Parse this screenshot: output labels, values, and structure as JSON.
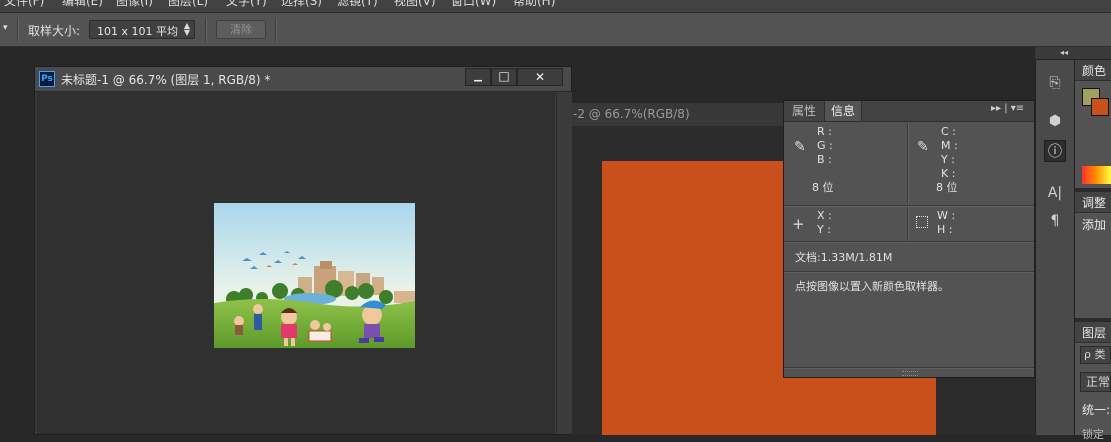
{
  "menubar": {
    "items": [
      "文件(F)",
      "编辑(E)",
      "图像(I)",
      "图层(L)",
      "文字(Y)",
      "选择(S)",
      "滤镜(T)",
      "视图(V)",
      "窗口(W)",
      "帮助(H)"
    ]
  },
  "options": {
    "tool_arrow": "▾",
    "sample_label": "取样大小:",
    "sample_value": "101 x 101 平均",
    "clear_label": "清除"
  },
  "doc1": {
    "ps_icon": "Ps",
    "title": "未标题-1 @ 66.7% (图层 1, RGB/8) *",
    "minimize": "▁",
    "maximize": "□",
    "close": "✕"
  },
  "doc2": {
    "title": "-2 @ 66.7%(RGB/8)",
    "canvas_color": "#c9501b"
  },
  "info_panel": {
    "tabs": [
      "属性",
      "信息"
    ],
    "menu": "▸▸ | ▾≡",
    "rgb": [
      "R :",
      "G :",
      "B :"
    ],
    "cmyk": [
      "C :",
      "M :",
      "Y :",
      "K :"
    ],
    "depth_left": "8 位",
    "depth_right": "8 位",
    "xy": [
      "X :",
      "Y :"
    ],
    "wh": [
      "W :",
      "H :"
    ],
    "doc_size": "文档:1.33M/1.81M",
    "hint": "点按图像以置入新颜色取样器。"
  },
  "right": {
    "collapse": "◂◂",
    "color_title": "颜色",
    "adjust_title": "调整",
    "adjust_add": "添加",
    "layers_title": "图层",
    "layers_search": "ρ 类",
    "blend_mode": "正常",
    "unify": "统一:",
    "lock": "锁定",
    "fg_color": "#a0a060",
    "bg_color": "#c9501b"
  },
  "icons": {
    "strip": [
      "history-icon",
      "3d-icon",
      "info-icon",
      "character-icon",
      "paragraph-icon"
    ]
  }
}
